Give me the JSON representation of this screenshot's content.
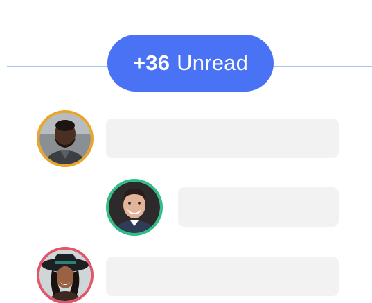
{
  "unread": {
    "count": "+36",
    "label": "Unread",
    "pill_color": "#4a72f5",
    "divider_color": "#a9c4f2"
  },
  "messages": [
    {
      "avatar_icon": "user-avatar-man-beard",
      "ring_color": "#e9a52a",
      "bubble_text": ""
    },
    {
      "avatar_icon": "user-avatar-man-smiling",
      "ring_color": "#2fbf86",
      "bubble_text": ""
    },
    {
      "avatar_icon": "user-avatar-woman-hat",
      "ring_color": "#e0566a",
      "bubble_text": ""
    }
  ]
}
